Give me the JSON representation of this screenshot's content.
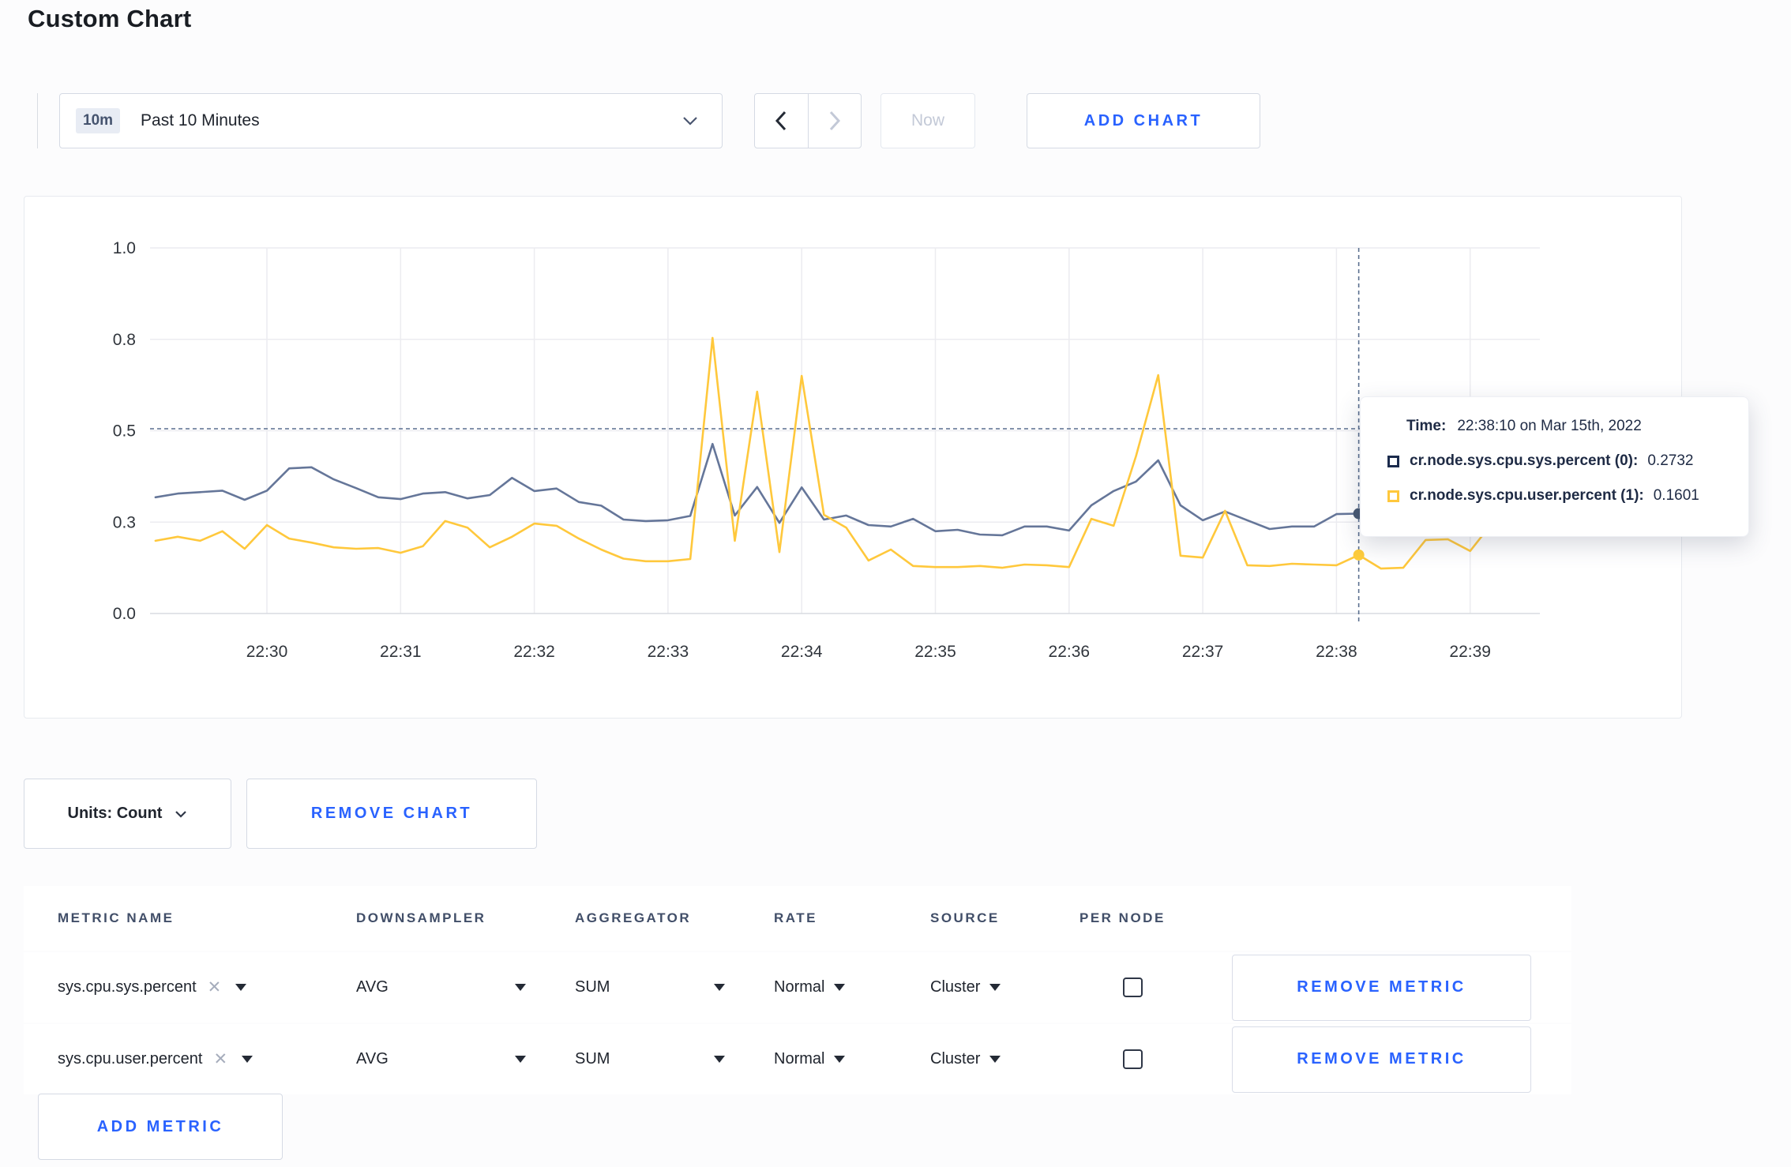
{
  "page": {
    "title": "Custom Chart"
  },
  "toolbar": {
    "time_badge": "10m",
    "time_label": "Past 10 Minutes",
    "now_label": "Now",
    "add_chart_label": "ADD CHART"
  },
  "controls": {
    "units_label": "Units: Count",
    "remove_chart_label": "REMOVE CHART",
    "add_metric_label": "ADD METRIC"
  },
  "tooltip": {
    "time_label": "Time:",
    "time_value": "22:38:10 on Mar 15th, 2022",
    "rows": [
      {
        "name": "cr.node.sys.cpu.sys.percent (0):",
        "value": "0.2732",
        "color": "#1b2b4d"
      },
      {
        "name": "cr.node.sys.cpu.user.percent (1):",
        "value": "0.1601",
        "color": "#ffc83d"
      }
    ]
  },
  "chart_data": {
    "type": "line",
    "title": "Custom Chart metrics (CPU percent)",
    "x_start": "22:29:10",
    "x_step_seconds": 10,
    "x_tick_labels": [
      "22:30",
      "22:31",
      "22:32",
      "22:33",
      "22:34",
      "22:35",
      "22:36",
      "22:37",
      "22:38",
      "22:39"
    ],
    "ylim": [
      0,
      1
    ],
    "y_tick_values": [
      0,
      0.25,
      0.5,
      0.75,
      1
    ],
    "y_tick_labels": [
      "0.0",
      "0.3",
      "0.5",
      "0.8",
      "1.0"
    ],
    "grid": true,
    "legend_position": "tooltip-only",
    "series": [
      {
        "name": "cr.node.sys.cpu.sys.percent",
        "color": "#657699",
        "values": [
          0.318,
          0.328,
          0.332,
          0.336,
          0.311,
          0.336,
          0.397,
          0.4,
          0.367,
          0.343,
          0.318,
          0.313,
          0.328,
          0.332,
          0.315,
          0.324,
          0.371,
          0.335,
          0.342,
          0.305,
          0.295,
          0.257,
          0.253,
          0.255,
          0.267,
          0.464,
          0.268,
          0.346,
          0.248,
          0.345,
          0.257,
          0.268,
          0.242,
          0.238,
          0.259,
          0.225,
          0.229,
          0.216,
          0.214,
          0.238,
          0.238,
          0.227,
          0.296,
          0.335,
          0.361,
          0.419,
          0.296,
          0.255,
          0.279,
          0.255,
          0.231,
          0.238,
          0.238,
          0.272,
          0.2732,
          0.262,
          0.255,
          0.266,
          0.255,
          0.25,
          0.245
        ]
      },
      {
        "name": "cr.node.sys.cpu.user.percent",
        "color": "#ffc83c",
        "values": [
          0.199,
          0.21,
          0.199,
          0.225,
          0.177,
          0.242,
          0.205,
          0.194,
          0.181,
          0.177,
          0.179,
          0.166,
          0.184,
          0.253,
          0.235,
          0.181,
          0.21,
          0.246,
          0.24,
          0.205,
          0.175,
          0.15,
          0.143,
          0.143,
          0.149,
          0.754,
          0.199,
          0.607,
          0.168,
          0.65,
          0.27,
          0.235,
          0.145,
          0.175,
          0.13,
          0.127,
          0.127,
          0.13,
          0.125,
          0.134,
          0.132,
          0.127,
          0.259,
          0.24,
          0.43,
          0.652,
          0.158,
          0.153,
          0.281,
          0.132,
          0.13,
          0.136,
          0.134,
          0.132,
          0.1601,
          0.123,
          0.125,
          0.201,
          0.203,
          0.171,
          0.248
        ]
      }
    ],
    "crosshair": {
      "index": 54,
      "hover_value": 0.5054,
      "time": "22:38:10"
    }
  },
  "table": {
    "headers": [
      "METRIC NAME",
      "DOWNSAMPLER",
      "AGGREGATOR",
      "RATE",
      "SOURCE",
      "PER NODE"
    ],
    "rows": [
      {
        "metric": "sys.cpu.sys.percent",
        "downsampler": "AVG",
        "aggregator": "SUM",
        "rate": "Normal",
        "source": "Cluster",
        "per_node_checked": false,
        "remove_label": "REMOVE METRIC"
      },
      {
        "metric": "sys.cpu.user.percent",
        "downsampler": "AVG",
        "aggregator": "SUM",
        "rate": "Normal",
        "source": "Cluster",
        "per_node_checked": false,
        "remove_label": "REMOVE METRIC"
      }
    ]
  },
  "colors": {
    "accent_blue": "#2962ff",
    "series_sys": "#657699",
    "series_user": "#ffc83c",
    "crosshair": "#5a6f8f",
    "gridline": "#ececf0"
  }
}
